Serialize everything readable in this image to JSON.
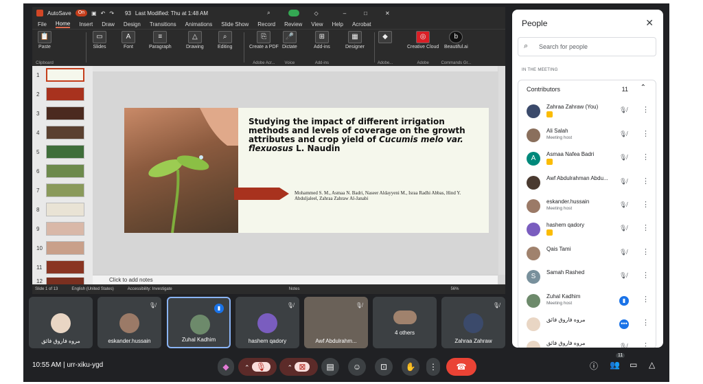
{
  "ppt": {
    "autosave_label": "AutoSave",
    "autosave_state": "On",
    "doc_percent": "93",
    "last_modified": "Last Modified: Thu at 1:48 AM",
    "menu": [
      "File",
      "Home",
      "Insert",
      "Draw",
      "Design",
      "Transitions",
      "Animations",
      "Slide Show",
      "Record",
      "Review",
      "View",
      "Help",
      "Acrobat"
    ],
    "ribbon": {
      "paste": "Paste",
      "clipboard": "Clipboard",
      "slides": "Slides",
      "font": "Font",
      "paragraph": "Paragraph",
      "drawing": "Drawing",
      "editing": "Editing",
      "create_pdf": "Create a PDF",
      "adobe_acro": "Adobe Acr...",
      "dictate": "Dictate",
      "voice": "Voice",
      "addins": "Add-ins",
      "addins_group": "Add-ins",
      "designer": "Designer",
      "adobe_group": "Adobe...",
      "creative_cloud": "Creative Cloud",
      "adobe": "Adobe",
      "beautiful": "Beautiful.ai",
      "commands": "Commands Gr..."
    },
    "slide_numbers": [
      "1",
      "2",
      "3",
      "4",
      "5",
      "6",
      "7",
      "8",
      "9",
      "10",
      "11",
      "12"
    ],
    "slide": {
      "title_part1": "Studying the impact of different irrigation methods and levels of coverage on the growth attributes and crop yield of ",
      "title_italic": "Cucumis melo var. flexuosus",
      "title_part2": " L. Naudin",
      "authors": "Mohammed S. M., Asmaa N. Badri, Naseer Aldayyeni M., Israa Radhi Abbas, Hind Y. Abduljaleel, Zahraa Zahraw Al-Janabi"
    },
    "notes_placeholder": "Click to add notes",
    "status": {
      "slide_of": "Slide 1 of 13",
      "language": "English (United States)",
      "accessibility": "Accessibility: Investigate",
      "notes": "Notes",
      "zoom": "56%"
    }
  },
  "tiles": [
    {
      "name": "مروه فاروق فائق"
    },
    {
      "name": "eskander.hussain"
    },
    {
      "name": "Zuhal Kadhim"
    },
    {
      "name": "hashem qadory"
    },
    {
      "name": "Awf Abdulrahm..."
    },
    {
      "name": "4 others"
    },
    {
      "name": "Zahraa Zahraw"
    }
  ],
  "bottom_bar": {
    "time": "10:55 AM",
    "separator": "|",
    "meeting_code": "urr-xiku-ygd",
    "people_count": "11"
  },
  "people_panel": {
    "title": "People",
    "search_placeholder": "Search for people",
    "section_label": "IN THE MEETING",
    "contributors_label": "Contributors",
    "contributors_count": "11",
    "rows": [
      {
        "name": "Zahraa Zahraw (You)",
        "sub": ""
      },
      {
        "name": "Ali Salah",
        "sub": "Meeting host"
      },
      {
        "name": "Asmaa Nafea Badri",
        "sub": "",
        "initial": "A"
      },
      {
        "name": "Awf Abdulrahman Abdu...",
        "sub": ""
      },
      {
        "name": "eskander.hussain",
        "sub": "Meeting host"
      },
      {
        "name": "hashem qadory",
        "sub": ""
      },
      {
        "name": "Qais Tami",
        "sub": ""
      },
      {
        "name": "Samah Rashed",
        "sub": "",
        "initial": "S"
      },
      {
        "name": "Zuhal Kadhim",
        "sub": "Meeting host"
      },
      {
        "name": "مروه فاروق فائق",
        "sub": ""
      },
      {
        "name": "مروه فاروق فائق",
        "sub": ""
      }
    ]
  },
  "colors": {
    "meet_bg": "#202124",
    "tile_bg": "#3c4043",
    "end_call": "#ea4335",
    "ppt_accent": "#c43e1c",
    "slide_arrow": "#a8321e"
  }
}
